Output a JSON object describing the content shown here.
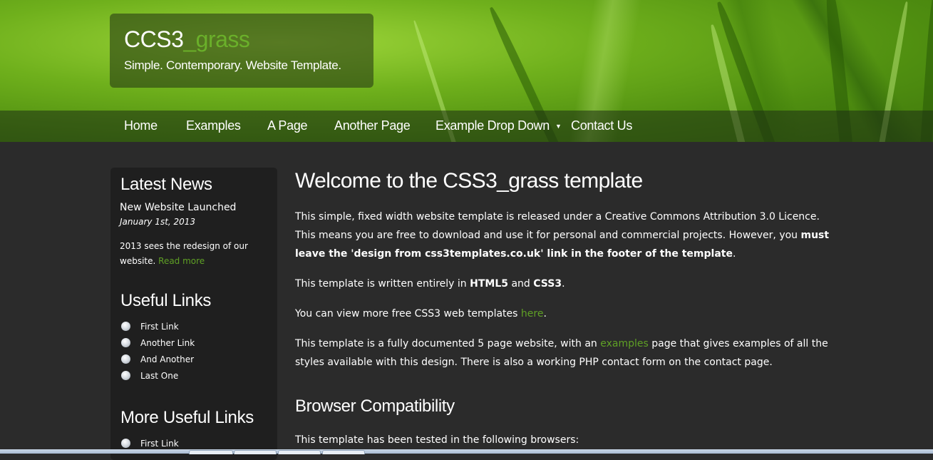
{
  "header": {
    "logo_main": "CCS3",
    "logo_accent": "_grass",
    "slogan": "Simple. Contemporary. Website Template."
  },
  "nav": {
    "items": [
      {
        "label": "Home"
      },
      {
        "label": "Examples"
      },
      {
        "label": "A Page"
      },
      {
        "label": "Another Page"
      },
      {
        "label": "Example Drop Down"
      },
      {
        "label": "Contact Us"
      }
    ]
  },
  "sidebar": {
    "latest_news": {
      "heading": "Latest News",
      "item_title": "New Website Launched",
      "item_date": "January 1st, 2013",
      "item_body": "2013 sees the redesign of our website.",
      "read_more": "Read more"
    },
    "useful_links": {
      "heading": "Useful Links",
      "items": [
        "First Link",
        "Another Link",
        "And Another",
        "Last One"
      ]
    },
    "more_useful_links": {
      "heading": "More Useful Links",
      "items": [
        "First Link"
      ]
    }
  },
  "content": {
    "title": "Welcome to the CSS3_grass template",
    "p1_a": "This simple, fixed width website template is released under a Creative Commons Attribution 3.0 Licence. This means you are free to download and use it for personal and commercial projects. However, you ",
    "p1_bold": "must leave the 'design from css3templates.co.uk' link in the footer of the template",
    "p1_end": ".",
    "p2_a": "This template is written entirely in ",
    "p2_b1": "HTML5",
    "p2_mid": " and ",
    "p2_b2": "CSS3",
    "p2_end": ".",
    "p3_a": "You can view more free CSS3 web templates ",
    "p3_link": "here",
    "p3_end": ".",
    "p4_a": "This template is a fully documented 5 page website, with an ",
    "p4_link": "examples",
    "p4_b": " page that gives examples of all the styles available with this design. There is also a working PHP contact form on the contact page.",
    "h2": "Browser Compatibility",
    "p5": "This template has been tested in the following browsers:"
  },
  "colors": {
    "accent_green": "#5fa025",
    "background": "#2b2b2b",
    "sidebar_bg": "#1f1f1f"
  }
}
